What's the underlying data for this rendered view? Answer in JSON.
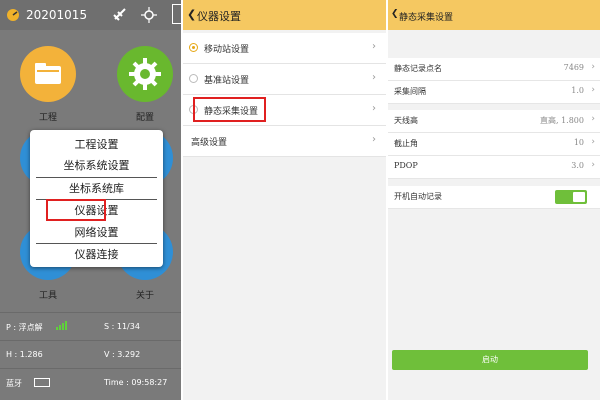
{
  "screen1": {
    "date": "20201015",
    "grid": [
      {
        "label": "工程",
        "icon": "folder-icon"
      },
      {
        "label": "配置",
        "icon": "gear-icon"
      },
      {
        "label": "工具",
        "icon": "tools-icon"
      },
      {
        "label": "关于",
        "icon": "info-icon"
      }
    ],
    "menu": [
      "工程设置",
      "坐标系统设置",
      "坐标系统库",
      "仪器设置",
      "网络设置",
      "仪器连接"
    ],
    "status": {
      "p": "P : 浮点解",
      "s": "S : 11/34",
      "h": "H : 1.286",
      "v": "V : 3.292",
      "bt": "蓝牙",
      "time": "Time : 09:58:27"
    },
    "colors": {
      "folder": "#f3b23a",
      "gear": "#69b82e",
      "blue": "#2f8fd6"
    }
  },
  "screen2": {
    "title": "仪器设置",
    "rows": [
      {
        "label": "移动站设置",
        "selected": true
      },
      {
        "label": "基准站设置",
        "selected": false
      },
      {
        "label": "静态采集设置",
        "selected": false
      },
      {
        "label": "高级设置",
        "selected": false
      }
    ]
  },
  "screen3": {
    "title": "静态采集设置",
    "rows": [
      {
        "label": "静态记录点名",
        "value": "7469"
      },
      {
        "label": "采集间隔",
        "value": "1.0"
      },
      {
        "label": "天线高",
        "value": "直高, 1.800"
      },
      {
        "label": "截止角",
        "value": "10"
      },
      {
        "label": "PDOP",
        "value": "3.0"
      }
    ],
    "auto_record_label": "开机自动记录",
    "auto_record_on": true,
    "start_label": "启动"
  }
}
